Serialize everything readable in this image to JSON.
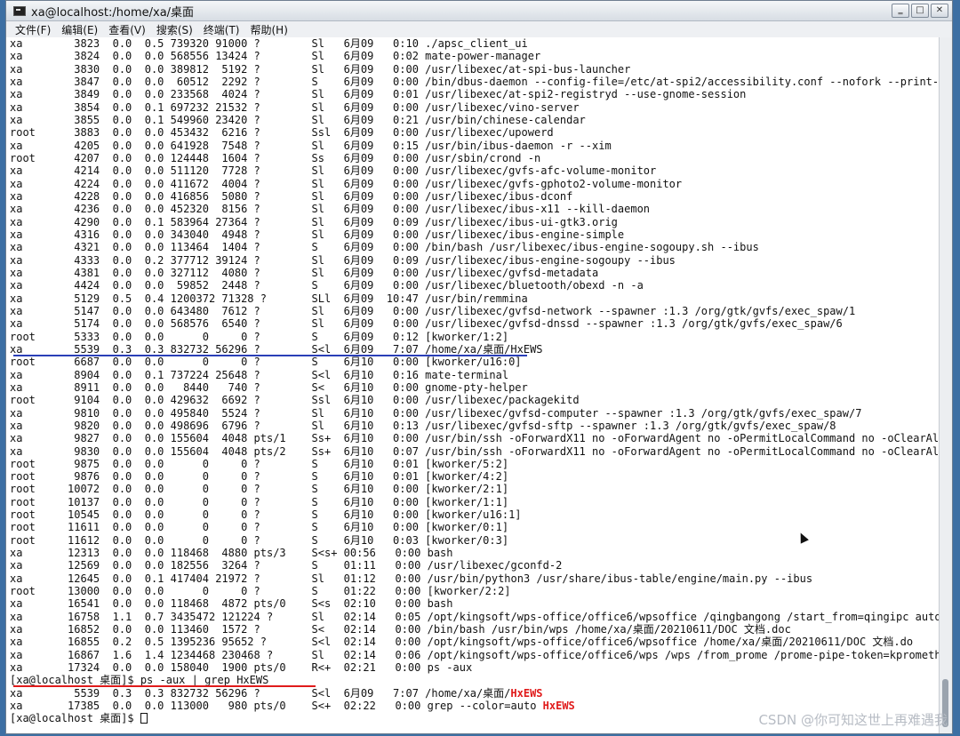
{
  "window": {
    "title": "xa@localhost:/home/xa/桌面",
    "buttons": {
      "minimize": "‗",
      "maximize": "□",
      "close": "✕"
    }
  },
  "menu": {
    "items": [
      "文件(F)",
      "编辑(E)",
      "查看(V)",
      "搜索(S)",
      "终端(T)",
      "帮助(H)"
    ]
  },
  "terminal": {
    "lines": [
      "xa        3823  0.0  0.5 739320 91000 ?        Sl   6月09   0:10 ./apsc_client_ui",
      "xa        3824  0.0  0.0 568556 13424 ?        Sl   6月09   0:02 mate-power-manager",
      "xa        3830  0.0  0.0 389812  5192 ?        Sl   6月09   0:00 /usr/libexec/at-spi-bus-launcher",
      "xa        3847  0.0  0.0  60512  2292 ?        S    6月09   0:00 /bin/dbus-daemon --config-file=/etc/at-spi2/accessibility.conf --nofork --print-",
      "xa        3849  0.0  0.0 233568  4024 ?        Sl   6月09   0:01 /usr/libexec/at-spi2-registryd --use-gnome-session",
      "xa        3854  0.0  0.1 697232 21532 ?        Sl   6月09   0:00 /usr/libexec/vino-server",
      "xa        3855  0.0  0.1 549960 23420 ?        Sl   6月09   0:21 /usr/bin/chinese-calendar",
      "root      3883  0.0  0.0 453432  6216 ?        Ssl  6月09   0:00 /usr/libexec/upowerd",
      "xa        4205  0.0  0.0 641928  7548 ?        Sl   6月09   0:15 /usr/bin/ibus-daemon -r --xim",
      "root      4207  0.0  0.0 124448  1604 ?        Ss   6月09   0:00 /usr/sbin/crond -n",
      "xa        4214  0.0  0.0 511120  7728 ?        Sl   6月09   0:00 /usr/libexec/gvfs-afc-volume-monitor",
      "xa        4224  0.0  0.0 411672  4004 ?        Sl   6月09   0:00 /usr/libexec/gvfs-gphoto2-volume-monitor",
      "xa        4228  0.0  0.0 416856  5080 ?        Sl   6月09   0:00 /usr/libexec/ibus-dconf",
      "xa        4236  0.0  0.0 452320  8156 ?        Sl   6月09   0:00 /usr/libexec/ibus-x11 --kill-daemon",
      "xa        4290  0.0  0.1 583964 27364 ?        Sl   6月09   0:09 /usr/libexec/ibus-ui-gtk3.orig",
      "xa        4316  0.0  0.0 343040  4948 ?        Sl   6月09   0:00 /usr/libexec/ibus-engine-simple",
      "xa        4321  0.0  0.0 113464  1404 ?        S    6月09   0:00 /bin/bash /usr/libexec/ibus-engine-sogoupy.sh --ibus",
      "xa        4333  0.0  0.2 377712 39124 ?        Sl   6月09   0:09 /usr/libexec/ibus-engine-sogoupy --ibus",
      "xa        4381  0.0  0.0 327112  4080 ?        Sl   6月09   0:00 /usr/libexec/gvfsd-metadata",
      "xa        4424  0.0  0.0  59852  2448 ?        S    6月09   0:00 /usr/libexec/bluetooth/obexd -n -a",
      "xa        5129  0.5  0.4 1200372 71328 ?       SLl  6月09  10:47 /usr/bin/remmina",
      "xa        5147  0.0  0.0 643480  7612 ?        Sl   6月09   0:00 /usr/libexec/gvfsd-network --spawner :1.3 /org/gtk/gvfs/exec_spaw/1",
      "xa        5174  0.0  0.0 568576  6540 ?        Sl   6月09   0:00 /usr/libexec/gvfsd-dnssd --spawner :1.3 /org/gtk/gvfs/exec_spaw/6",
      "root      5333  0.0  0.0      0     0 ?        S    6月09   0:12 [kworker/1:2]",
      "xa        5539  0.3  0.3 832732 56296 ?        S<l  6月09   7:07 /home/xa/桌面/HxEWS",
      "root      6687  0.0  0.0      0     0 ?        S    6月10   0:00 [kworker/u16:0]",
      "xa        8904  0.0  0.1 737224 25648 ?        S<l  6月10   0:16 mate-terminal",
      "xa        8911  0.0  0.0   8440   740 ?        S<   6月10   0:00 gnome-pty-helper",
      "root      9104  0.0  0.0 429632  6692 ?        Ssl  6月10   0:00 /usr/libexec/packagekitd",
      "xa        9810  0.0  0.0 495840  5524 ?        Sl   6月10   0:00 /usr/libexec/gvfsd-computer --spawner :1.3 /org/gtk/gvfs/exec_spaw/7",
      "xa        9820  0.0  0.0 498696  6796 ?        Sl   6月10   0:13 /usr/libexec/gvfsd-sftp --spawner :1.3 /org/gtk/gvfs/exec_spaw/8",
      "xa        9827  0.0  0.0 155604  4048 pts/1    Ss+  6月10   0:00 /usr/bin/ssh -oForwardX11 no -oForwardAgent no -oPermitLocalCommand no -oClearAl",
      "xa        9830  0.0  0.0 155604  4048 pts/2    Ss+  6月10   0:07 /usr/bin/ssh -oForwardX11 no -oForwardAgent no -oPermitLocalCommand no -oClearAl",
      "root      9875  0.0  0.0      0     0 ?        S    6月10   0:01 [kworker/5:2]",
      "root      9876  0.0  0.0      0     0 ?        S    6月10   0:01 [kworker/4:2]",
      "root     10072  0.0  0.0      0     0 ?        S    6月10   0:00 [kworker/2:1]",
      "root     10137  0.0  0.0      0     0 ?        S    6月10   0:00 [kworker/1:1]",
      "root     10545  0.0  0.0      0     0 ?        S    6月10   0:00 [kworker/u16:1]",
      "root     11611  0.0  0.0      0     0 ?        S    6月10   0:00 [kworker/0:1]",
      "root     11612  0.0  0.0      0     0 ?        S    6月10   0:03 [kworker/0:3]",
      "xa       12313  0.0  0.0 118468  4880 pts/3    S<s+ 00:56   0:00 bash",
      "xa       12569  0.0  0.0 182556  3264 ?        S    01:11   0:00 /usr/libexec/gconfd-2",
      "xa       12645  0.0  0.1 417404 21972 ?        Sl   01:12   0:00 /usr/bin/python3 /usr/share/ibus-table/engine/main.py --ibus",
      "root     13000  0.0  0.0      0     0 ?        S    01:22   0:00 [kworker/2:2]",
      "xa       16541  0.0  0.0 118468  4872 pts/0    S<s  02:10   0:00 bash",
      "xa       16758  1.1  0.7 3435472 121224 ?      Sl   02:14   0:05 /opt/kingsoft/wps-office/office6/wpsoffice /qingbangong /start_from=qingipc autol",
      "xa       16852  0.0  0.0 113460  1572 ?        S<   02:14   0:00 /bin/bash /usr/bin/wps /home/xa/桌面/20210611/DOC 文档.doc",
      "xa       16855  0.2  0.5 1395236 95652 ?       S<l  02:14   0:00 /opt/kingsoft/wps-office/office6/wpsoffice /home/xa/桌面/20210611/DOC 文档.do",
      "xa       16867  1.6  1.4 1234468 230468 ?      Sl   02:14   0:06 /opt/kingsoft/wps-office/office6/wps /wps /from_prome /prome-pipe-token=kpromethe",
      "xa       17324  0.0  0.0 158040  1900 pts/0    R<+  02:21   0:00 ps -aux",
      "[xa@localhost 桌面]$ ps -aux | grep HxEWS"
    ],
    "grep_results": [
      {
        "prefix": "xa        5539  0.3  0.3 832732 56296 ?        S<l  6月09   7:07 /home/xa/桌面/",
        "match": "HxEWS"
      },
      {
        "prefix": "xa       17385  0.0  0.0 113000   980 pts/0    S<+  02:22   0:00 grep --color=auto ",
        "match": "HxEWS"
      }
    ],
    "prompt": "[xa@localhost 桌面]$ "
  },
  "watermark": "CSDN @你可知这世上再难遇我",
  "colors": {
    "highlight": "#e01b1b",
    "blue_mark": "#2a3fb7",
    "desktop": "#3d6fa3"
  }
}
